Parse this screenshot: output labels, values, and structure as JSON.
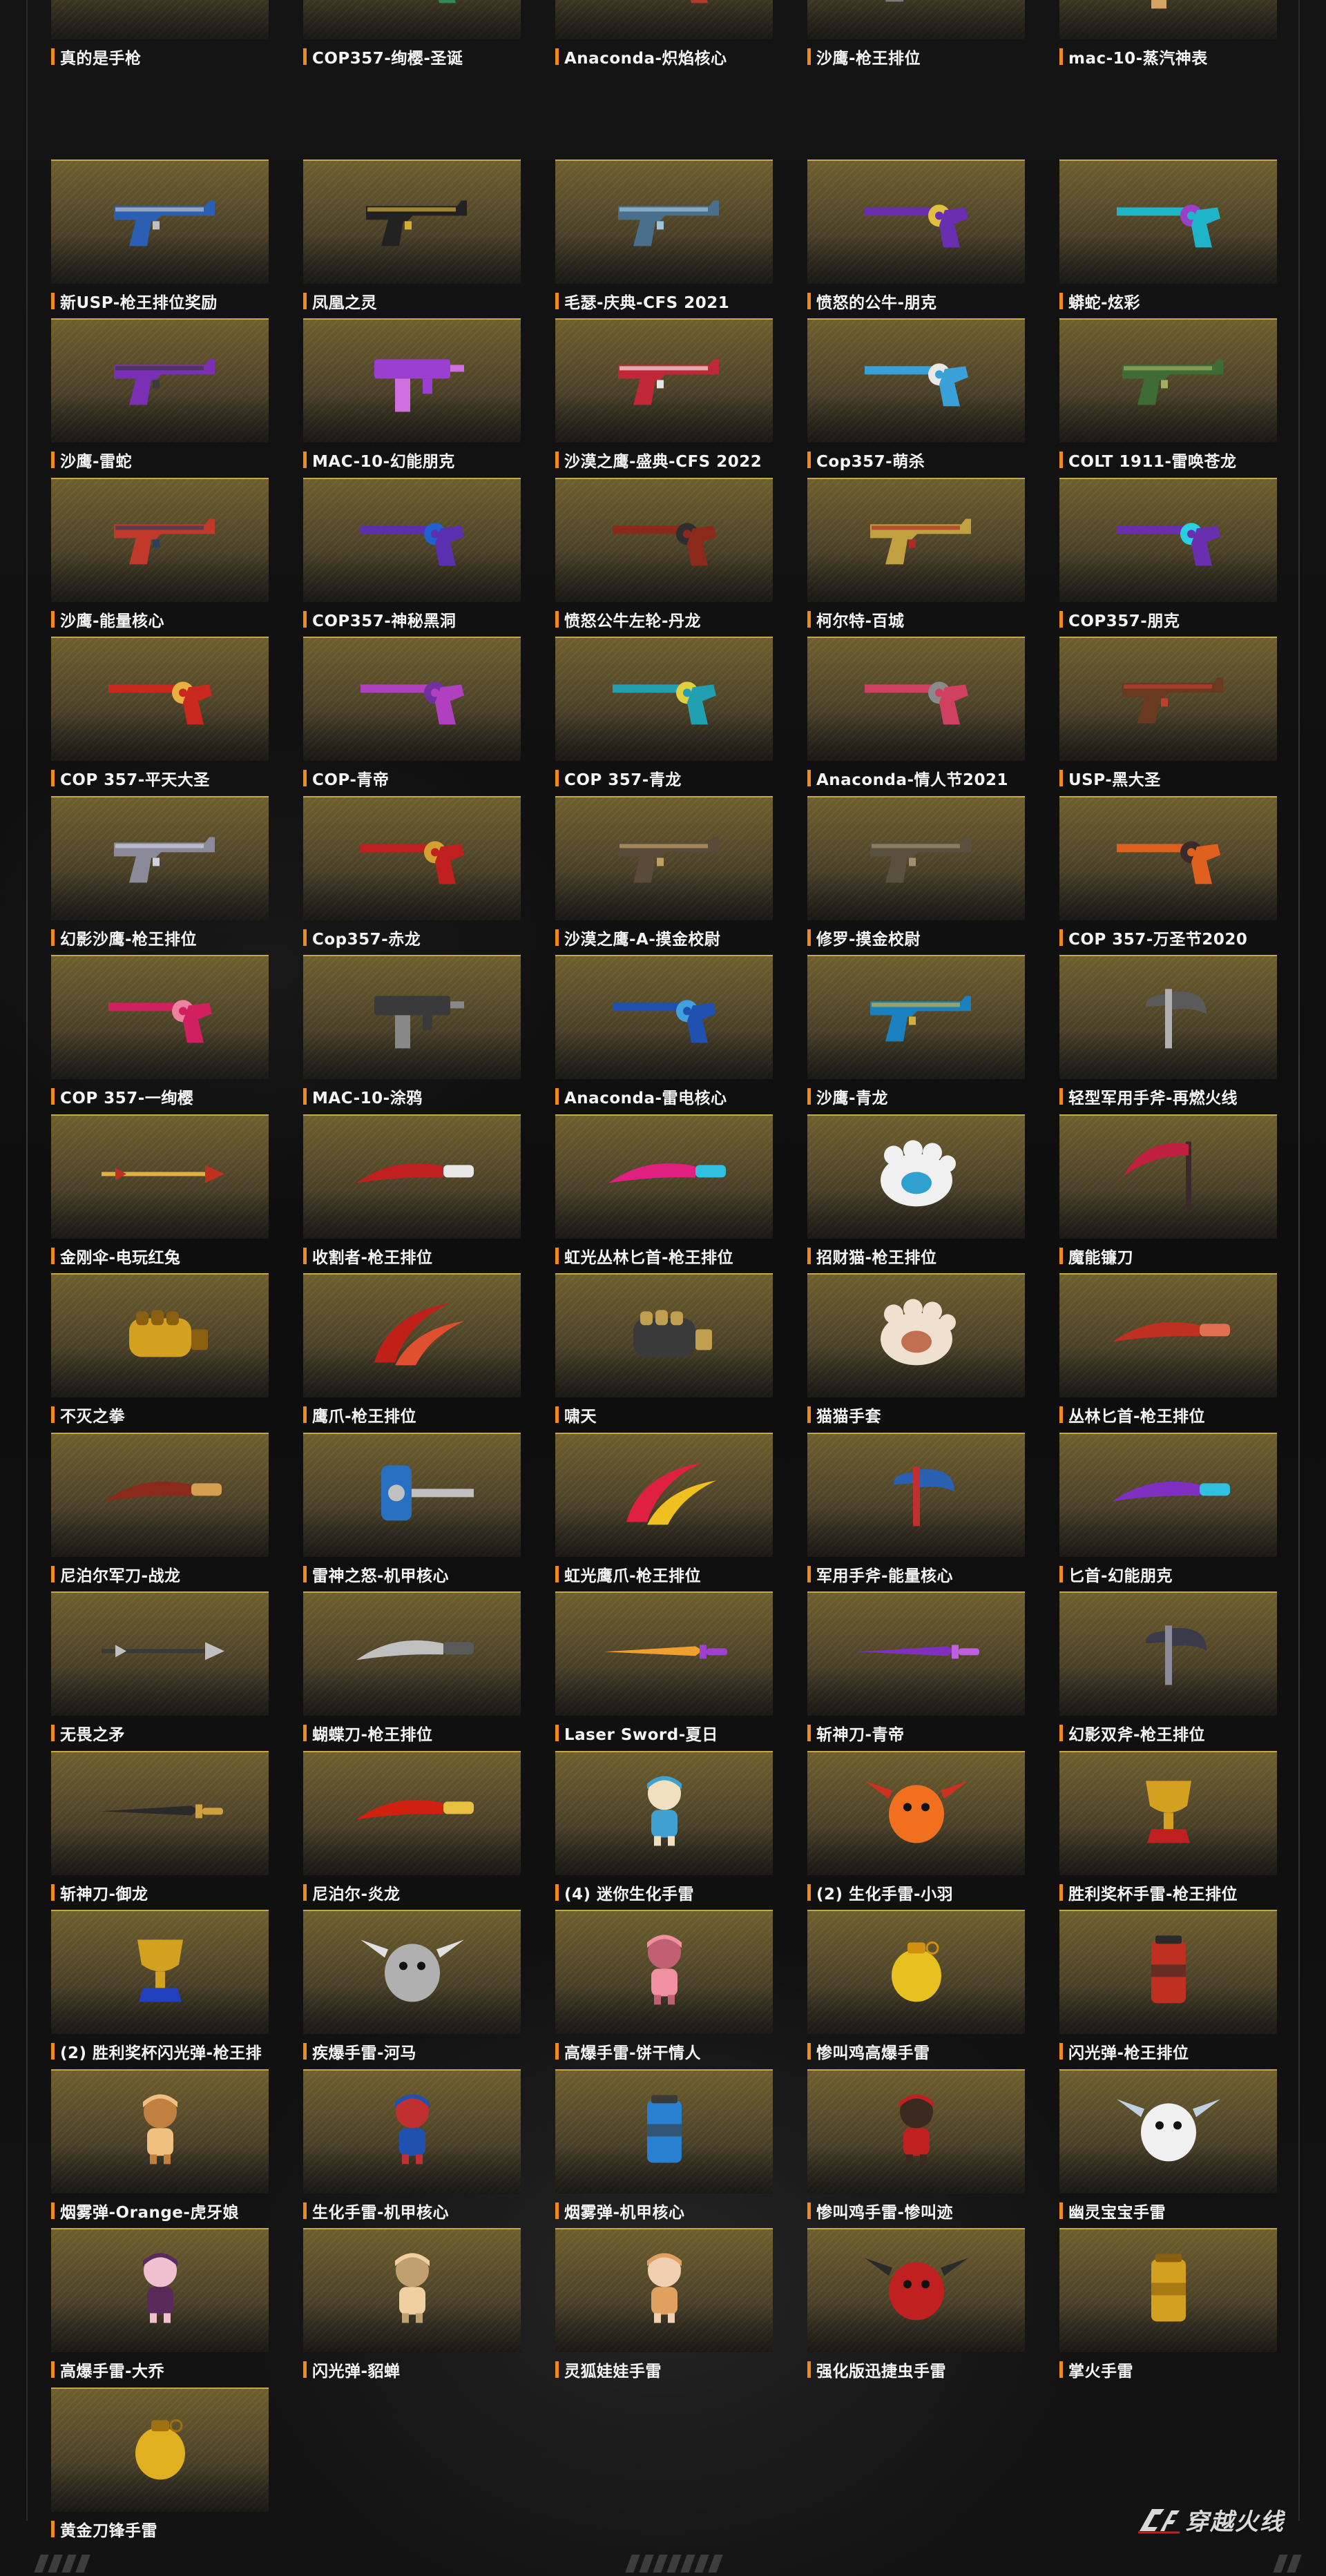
{
  "items": [
    {
      "label": "真的是手枪",
      "art": "glove",
      "colors": [
        "#d8a27c",
        "#f2c7a2"
      ]
    },
    {
      "label": "COP357-绚樱-圣诞",
      "art": "revolver",
      "colors": [
        "#2e8b57",
        "#c0392b"
      ]
    },
    {
      "label": "Anaconda-炽焰核心",
      "art": "revolver",
      "colors": [
        "#b23a2a",
        "#f4a340"
      ]
    },
    {
      "label": "沙鹰-枪王排位",
      "art": "pistol",
      "colors": [
        "#7a7a7a",
        "#d0d0d0"
      ]
    },
    {
      "label": "mac-10-蒸汽神表",
      "art": "smg",
      "colors": [
        "#8b5a2b",
        "#d4a460"
      ]
    },
    {
      "label": "新USP-枪王排位奖励",
      "art": "pistol",
      "colors": [
        "#2b5fb3",
        "#c0c0c0"
      ]
    },
    {
      "label": "凤凰之灵",
      "art": "pistol",
      "colors": [
        "#222222",
        "#d4af37"
      ]
    },
    {
      "label": "毛瑟-庆典-CFS 2021",
      "art": "pistol",
      "colors": [
        "#4a6f8c",
        "#9fc3d9"
      ]
    },
    {
      "label": "愤怒的公牛-朋克",
      "art": "revolver",
      "colors": [
        "#6a2fb0",
        "#e0c040"
      ]
    },
    {
      "label": "蟒蛇-炫彩",
      "art": "revolver",
      "colors": [
        "#1fb5c9",
        "#9b3fc9"
      ]
    },
    {
      "label": "沙鹰-雷蛇",
      "art": "pistol",
      "colors": [
        "#7b2fb5",
        "#3a3a3a"
      ]
    },
    {
      "label": "MAC-10-幻能朋克",
      "art": "smg",
      "colors": [
        "#9a3fd0",
        "#d070e0"
      ]
    },
    {
      "label": "沙漠之鹰-盛典-CFS 2022",
      "art": "pistol",
      "colors": [
        "#c02838",
        "#e5e5e5"
      ]
    },
    {
      "label": "Cop357-萌杀",
      "art": "revolver",
      "colors": [
        "#3aa0d8",
        "#e8e8e8"
      ]
    },
    {
      "label": "COLT 1911-雷唤苍龙",
      "art": "pistol",
      "colors": [
        "#3f6b35",
        "#a0b060"
      ]
    },
    {
      "label": "沙鹰-能量核心",
      "art": "pistol",
      "colors": [
        "#c0392b",
        "#2e3e60"
      ]
    },
    {
      "label": "COP357-神秘黑洞",
      "art": "revolver",
      "colors": [
        "#5b2fb0",
        "#2060d0"
      ]
    },
    {
      "label": "愤怒公牛左轮-丹龙",
      "art": "revolver",
      "colors": [
        "#8b2a1a",
        "#2e2e2e"
      ]
    },
    {
      "label": "柯尔特-百城",
      "art": "pistol",
      "colors": [
        "#c0a040",
        "#b02a2a"
      ]
    },
    {
      "label": "COP357-朋克",
      "art": "revolver",
      "colors": [
        "#6a2fb0",
        "#2ad0e0"
      ]
    },
    {
      "label": "COP 357-平天大圣",
      "art": "revolver",
      "colors": [
        "#c8281e",
        "#e8b040"
      ]
    },
    {
      "label": "COP-青帝",
      "art": "revolver",
      "colors": [
        "#b040c0",
        "#7030a0"
      ]
    },
    {
      "label": "COP 357-青龙",
      "art": "revolver",
      "colors": [
        "#20a0b0",
        "#e0d040"
      ]
    },
    {
      "label": "Anaconda-情人节2021",
      "art": "revolver",
      "colors": [
        "#d04060",
        "#8a8a8a"
      ]
    },
    {
      "label": "USP-黑大圣",
      "art": "pistol",
      "colors": [
        "#6a3a20",
        "#c04030"
      ]
    },
    {
      "label": "幻影沙鹰-枪王排位",
      "art": "pistol",
      "colors": [
        "#8a8a9a",
        "#d0d0e0"
      ]
    },
    {
      "label": "Cop357-赤龙",
      "art": "revolver",
      "colors": [
        "#c02020",
        "#d4a030"
      ]
    },
    {
      "label": "沙漠之鹰-A-摸金校尉",
      "art": "pistol",
      "colors": [
        "#5a4a3a",
        "#c0a060"
      ]
    },
    {
      "label": "修罗-摸金校尉",
      "art": "pistol",
      "colors": [
        "#5a5040",
        "#a09070"
      ]
    },
    {
      "label": "COP 357-万圣节2020",
      "art": "revolver",
      "colors": [
        "#e06020",
        "#3a2a2a"
      ]
    },
    {
      "label": "COP 357-一绚樱",
      "art": "revolver",
      "colors": [
        "#d02060",
        "#f080a0"
      ]
    },
    {
      "label": "MAC-10-涂鸦",
      "art": "smg",
      "colors": [
        "#3a3a3a",
        "#888888"
      ]
    },
    {
      "label": "Anaconda-雷电核心",
      "art": "revolver",
      "colors": [
        "#2050b0",
        "#40a0e0"
      ]
    },
    {
      "label": "沙鹰-青龙",
      "art": "pistol",
      "colors": [
        "#1a80c0",
        "#d0b040"
      ]
    },
    {
      "label": "轻型军用手斧-再燃火线",
      "art": "axe",
      "colors": [
        "#5a5a5a",
        "#b0b0b0"
      ]
    },
    {
      "label": "金刚伞-电玩红兔",
      "art": "spear",
      "colors": [
        "#c03020",
        "#e0b040"
      ]
    },
    {
      "label": "收割者-枪王排位",
      "art": "knife",
      "colors": [
        "#c02020",
        "#e8e8e8"
      ]
    },
    {
      "label": "虹光丛林匕首-枪王排位",
      "art": "knife",
      "colors": [
        "#e02080",
        "#30c0e0"
      ]
    },
    {
      "label": "招财猫-枪王排位",
      "art": "paw",
      "colors": [
        "#f0f0f0",
        "#30a0d0"
      ]
    },
    {
      "label": "魔能镰刀",
      "art": "scythe",
      "colors": [
        "#c02040",
        "#3a2a2a"
      ]
    },
    {
      "label": "不灭之拳",
      "art": "fist",
      "colors": [
        "#d4a020",
        "#8a6010"
      ]
    },
    {
      "label": "鹰爪-枪王排位",
      "art": "claw",
      "colors": [
        "#c02018",
        "#e05030"
      ]
    },
    {
      "label": "啸天",
      "art": "fist",
      "colors": [
        "#3a3a3a",
        "#c0a050"
      ]
    },
    {
      "label": "猫猫手套",
      "art": "paw",
      "colors": [
        "#f0e0d0",
        "#c07050"
      ]
    },
    {
      "label": "丛林匕首-枪王排位",
      "art": "knife",
      "colors": [
        "#c03020",
        "#e07050"
      ]
    },
    {
      "label": "尼泊尔军刀-战龙",
      "art": "knife",
      "colors": [
        "#8a2a1a",
        "#d4a050"
      ]
    },
    {
      "label": "雷神之怒-机甲核心",
      "art": "hammer",
      "colors": [
        "#2a70c0",
        "#c0c0c0"
      ]
    },
    {
      "label": "虹光鹰爪-枪王排位",
      "art": "claw",
      "colors": [
        "#e02040",
        "#f0c020"
      ]
    },
    {
      "label": "军用手斧-能量核心",
      "art": "axe",
      "colors": [
        "#2a60b0",
        "#c03030"
      ]
    },
    {
      "label": "匕首-幻能朋克",
      "art": "knife",
      "colors": [
        "#8030c0",
        "#30c0e0"
      ]
    },
    {
      "label": "无畏之矛",
      "art": "spear",
      "colors": [
        "#c0c0c0",
        "#3a3a3a"
      ]
    },
    {
      "label": "蝴蝶刀-枪王排位",
      "art": "knife",
      "colors": [
        "#c0c0c0",
        "#5a5a5a"
      ]
    },
    {
      "label": "Laser Sword-夏日",
      "art": "sword",
      "colors": [
        "#f0a030",
        "#a040d0"
      ]
    },
    {
      "label": "斩神刀-青帝",
      "art": "sword",
      "colors": [
        "#8030c0",
        "#c060e0"
      ]
    },
    {
      "label": "幻影双斧-枪王排位",
      "art": "axe",
      "colors": [
        "#3a3a4a",
        "#8a8a9a"
      ]
    },
    {
      "label": "斩神刀-御龙",
      "art": "sword",
      "colors": [
        "#2a2a2a",
        "#d0a040"
      ]
    },
    {
      "label": "尼泊尔-炎龙",
      "art": "knife",
      "colors": [
        "#d02010",
        "#e8c040"
      ]
    },
    {
      "label": "(4) 迷你生化手雷",
      "art": "doll",
      "colors": [
        "#40a0d0",
        "#f0e0c0"
      ]
    },
    {
      "label": "(2) 生化手雷-小羽",
      "art": "creature",
      "colors": [
        "#f07020",
        "#d03020"
      ]
    },
    {
      "label": "胜利奖杯手雷-枪王排位",
      "art": "trophy",
      "colors": [
        "#d4a020",
        "#c02020"
      ]
    },
    {
      "label": "(2) 胜利奖杯闪光弹-枪王排",
      "art": "trophy",
      "colors": [
        "#d4a020",
        "#2040c0"
      ]
    },
    {
      "label": "疾爆手雷-河马",
      "art": "creature",
      "colors": [
        "#b0b0b0",
        "#e0e0e0"
      ]
    },
    {
      "label": "高爆手雷-饼干情人",
      "art": "doll",
      "colors": [
        "#f090a0",
        "#c06070"
      ]
    },
    {
      "label": "惨叫鸡高爆手雷",
      "art": "grenade",
      "colors": [
        "#e8c020",
        "#d09010"
      ]
    },
    {
      "label": "闪光弹-枪王排位",
      "art": "can",
      "colors": [
        "#c03020",
        "#2a2a2a"
      ]
    },
    {
      "label": "烟雾弹-Orange-虎牙娘",
      "art": "doll",
      "colors": [
        "#f0c080",
        "#c08040"
      ]
    },
    {
      "label": "生化手雷-机甲核心",
      "art": "doll",
      "colors": [
        "#2050b0",
        "#c03030"
      ]
    },
    {
      "label": "烟雾弹-机甲核心",
      "art": "can",
      "colors": [
        "#2a80d0",
        "#3a3a3a"
      ]
    },
    {
      "label": "惨叫鸡手雷-惨叫迹",
      "art": "doll",
      "colors": [
        "#c02020",
        "#3a2a20"
      ]
    },
    {
      "label": "幽灵宝宝手雷",
      "art": "creature",
      "colors": [
        "#f0f0f0",
        "#c0d0e0"
      ]
    },
    {
      "label": "高爆手雷-大乔",
      "art": "doll",
      "colors": [
        "#5a2a5a",
        "#f0c0d0"
      ]
    },
    {
      "label": "闪光弹-貂蝉",
      "art": "doll",
      "colors": [
        "#f0d0a0",
        "#c0a070"
      ]
    },
    {
      "label": "灵狐娃娃手雷",
      "art": "doll",
      "colors": [
        "#e0a060",
        "#f0d0b0"
      ]
    },
    {
      "label": "强化版迅捷虫手雷",
      "art": "creature",
      "colors": [
        "#c02020",
        "#2a2a2a"
      ]
    },
    {
      "label": "掌火手雷",
      "art": "can",
      "colors": [
        "#d4a020",
        "#8a6010"
      ]
    },
    {
      "label": "黄金刀锋手雷",
      "art": "grenade",
      "colors": [
        "#e0b020",
        "#a07010"
      ]
    }
  ],
  "footer": {
    "brand_text": "穿越火线",
    "logo_icon": "cf-logo-icon",
    "accent_color": "#f08a1c"
  }
}
